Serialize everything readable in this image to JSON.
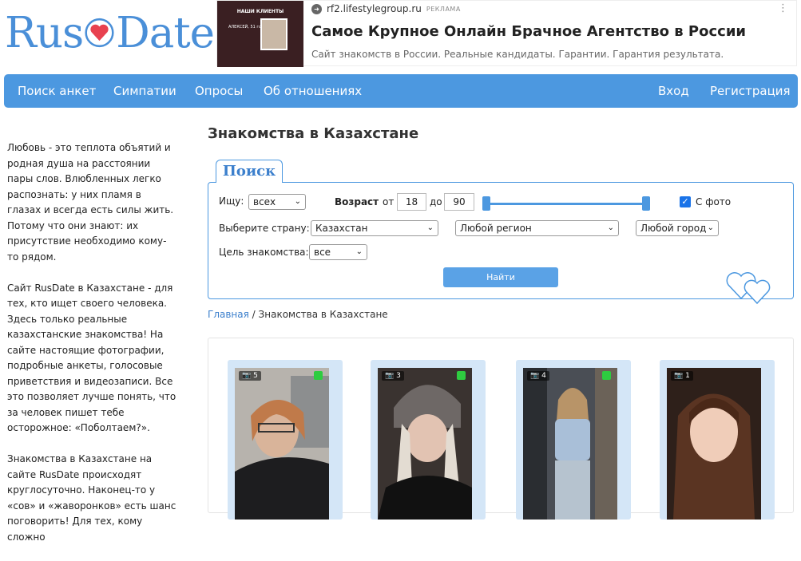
{
  "logo": {
    "text_left": "Rus",
    "text_right": "Date"
  },
  "ad": {
    "thumb_caption": "НАШИ КЛИЕНТЫ",
    "thumb_name": "АЛЕКСЕЙ, 51 год",
    "url": "rf2.lifestylegroup.ru",
    "tag": "РЕКЛАМА",
    "title": "Самое Крупное Онлайн Брачное Агентство в России",
    "description": "Сайт знакомств в России. Реальные кандидаты. Гарантии. Гарантия результата.",
    "more": "⋮"
  },
  "nav": {
    "items": [
      "Поиск анкет",
      "Симпатии",
      "Опросы",
      "Об отношениях"
    ],
    "login": "Вход",
    "register": "Регистрация"
  },
  "sidebar": {
    "paragraphs": [
      "Любовь - это теплота объятий и родная душа на расстоянии пары слов. Влюбленных легко распознать: у них пламя в глазах и всегда есть силы жить. Потому что они знают: их присутствие необходимо кому-то рядом.",
      "Сайт RusDate в Казахстане - для тех, кто ищет своего человека. Здесь только реальные казахстанские знакомства! На сайте настоящие фотографии, подробные анкеты, голосовые приветствия и видеозаписи. Все это позволяет лучше понять, что за человек пишет тебе осторожное: «Поболтаем?».",
      "Знакомства в Казахстане на сайте RusDate происходят круглосуточно. Наконец-то у «сов» и «жаворонков» есть шанс поговорить! Для тех, кому сложно"
    ]
  },
  "page_title": "Знакомства в Казахстане",
  "search": {
    "tab_label": "Поиск",
    "seek_label": "Ищу:",
    "seek_value": "всех",
    "age_label": "Возраст",
    "from_label": "от",
    "age_from": "18",
    "to_label": "до",
    "age_to": "90",
    "age_range": [
      18,
      90
    ],
    "with_photo_label": "С фото",
    "with_photo_checked": true,
    "country_label": "Выберите страну:",
    "country_value": "Казахстан",
    "region_value": "Любой регион",
    "city_value": "Любой город",
    "goal_label": "Цель знакомства:",
    "goal_value": "все",
    "find_button": "Найти"
  },
  "breadcrumb": {
    "home": "Главная",
    "sep": "/",
    "current": "Знакомства в Казахстане"
  },
  "profiles": [
    {
      "photos": "5",
      "online": true
    },
    {
      "photos": "3",
      "online": true
    },
    {
      "photos": "4",
      "online": true
    },
    {
      "photos": "1",
      "online": false
    }
  ],
  "colors": {
    "accent": "#4c98e0",
    "online": "#2ecc40",
    "logo_heart": "#e8414f"
  }
}
